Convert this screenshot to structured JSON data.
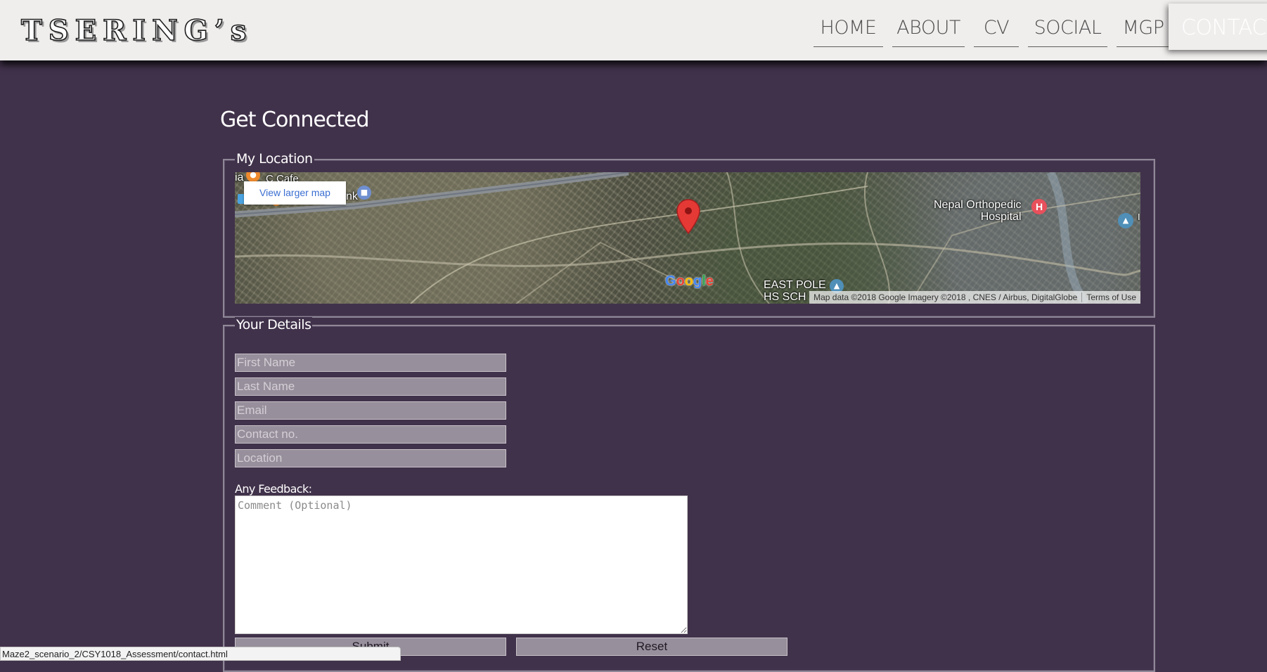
{
  "header": {
    "brand": "TSERING’s",
    "nav": [
      {
        "label": "HOME"
      },
      {
        "label": "ABOUT"
      },
      {
        "label": "CV"
      },
      {
        "label": "SOCIAL"
      },
      {
        "label": "MGP"
      }
    ],
    "active": "CONTACT"
  },
  "main": {
    "title": "Get Connected",
    "location_legend": "My Location",
    "details_legend": "Your Details"
  },
  "map": {
    "view_larger": "View larger map",
    "labels": {
      "cafe": "C Cafe",
      "bank": "nk",
      "edge_left": "ia",
      "hospital": "Nepal Orthopedic\nHospital",
      "school": "EAST POLE\nHS SCH"
    },
    "google": "Google",
    "attribution": "Map data ©2018 Google Imagery ©2018 , CNES / Airbus, DigitalGlobe",
    "terms": "Terms of Use"
  },
  "form": {
    "first_name_placeholder": "First Name",
    "last_name_placeholder": "Last Name",
    "email_placeholder": "Email",
    "contact_placeholder": "Contact no.",
    "location_placeholder": "Location",
    "feedback_label": "Any Feedback:",
    "comment_placeholder": "Comment (Optional)",
    "submit_label": "Submit",
    "reset_label": "Reset"
  },
  "status": {
    "url": "Maze2_scenario_2/CSY1018_Assessment/contact.html"
  },
  "colors": {
    "background": "#41324b",
    "header": "#f0eeed",
    "input_bg": "#978f9b"
  }
}
